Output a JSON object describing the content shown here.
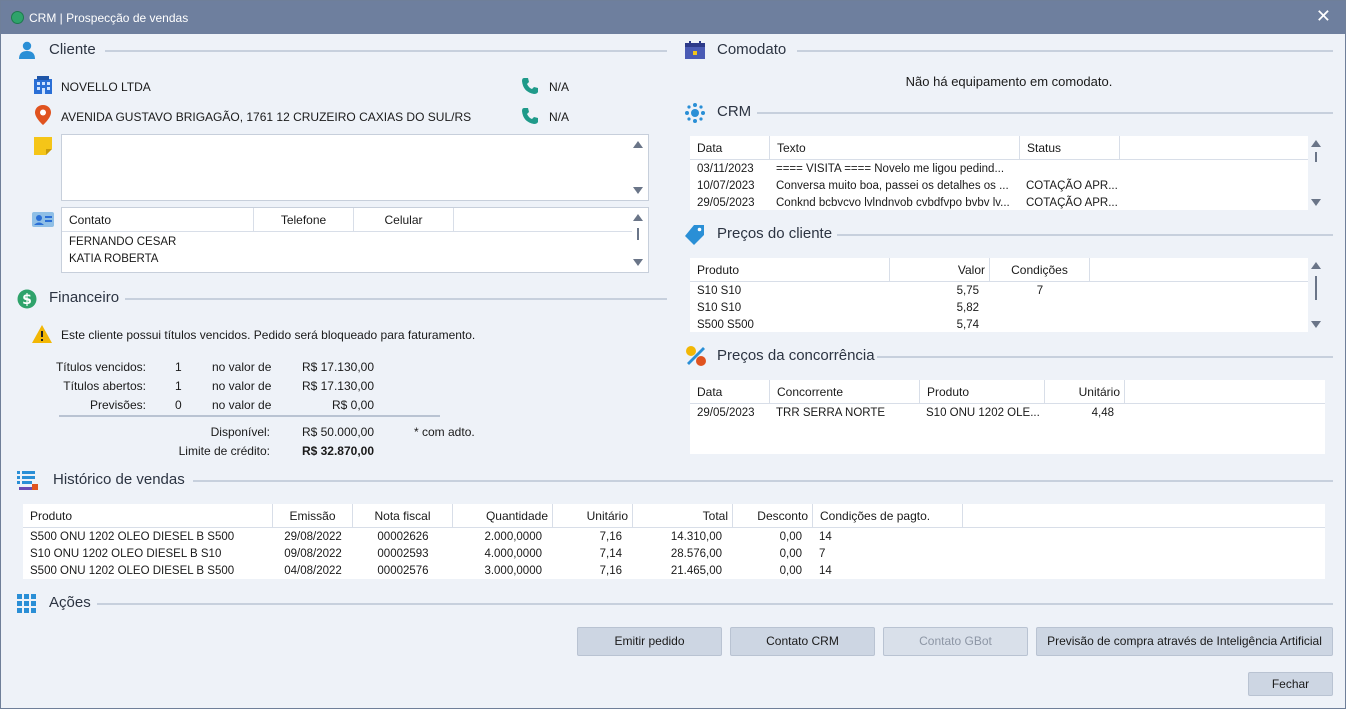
{
  "window": {
    "title": "CRM | Prospecção de vendas"
  },
  "cliente": {
    "section_title": "Cliente",
    "name": "NOVELLO LTDA",
    "address": "AVENIDA GUSTAVO BRIGAGÃO, 1761 12 CRUZEIRO CAXIAS DO SUL/RS",
    "phone1": "N/A",
    "phone2": "N/A",
    "notes": "",
    "contacts_headers": [
      "Contato",
      "Telefone",
      "Celular"
    ],
    "contacts": [
      {
        "contato": "FERNANDO CESAR",
        "telefone": "",
        "celular": ""
      },
      {
        "contato": "KATIA ROBERTA",
        "telefone": "",
        "celular": ""
      }
    ]
  },
  "financeiro": {
    "section_title": "Financeiro",
    "warning": "Este cliente possui títulos vencidos. Pedido será bloqueado para faturamento.",
    "rows": [
      {
        "label": "Títulos vencidos:",
        "count": "1",
        "mid": "no valor de",
        "value": "R$ 17.130,00"
      },
      {
        "label": "Títulos abertos:",
        "count": "1",
        "mid": "no valor de",
        "value": "R$ 17.130,00"
      },
      {
        "label": "Previsões:",
        "count": "0",
        "mid": "no valor de",
        "value": "R$ 0,00"
      }
    ],
    "disponivel_label": "Disponível:",
    "disponivel_value": "R$ 50.000,00",
    "adto_note": "* com adto.",
    "limite_label": "Limite de crédito:",
    "limite_value": "R$ 32.870,00"
  },
  "comodato": {
    "section_title": "Comodato",
    "message": "Não há equipamento em comodato."
  },
  "crm": {
    "section_title": "CRM",
    "headers": [
      "Data",
      "Texto",
      "Status"
    ],
    "rows": [
      {
        "data": "03/11/2023",
        "texto": "==== VISITA ==== Novelo me ligou pedind...",
        "status": ""
      },
      {
        "data": "10/07/2023",
        "texto": "Conversa muito boa, passei os detalhes os ...",
        "status": "COTAÇÃO APR..."
      },
      {
        "data": "29/05/2023",
        "texto": "Conknd bcbvcvo lvlndnvob cvbdfvpo bvbv lv...",
        "status": "COTAÇÃO APR..."
      }
    ]
  },
  "precos_cliente": {
    "section_title": "Preços do cliente",
    "headers": [
      "Produto",
      "Valor",
      "Condições"
    ],
    "rows": [
      {
        "produto": "S10 S10",
        "valor": "5,75",
        "condicoes": "7"
      },
      {
        "produto": "S10 S10",
        "valor": "5,82",
        "condicoes": ""
      },
      {
        "produto": "S500 S500",
        "valor": "5,74",
        "condicoes": ""
      }
    ]
  },
  "precos_concorrencia": {
    "section_title": "Preços da concorrência",
    "headers": [
      "Data",
      "Concorrente",
      "Produto",
      "Unitário"
    ],
    "rows": [
      {
        "data": "29/05/2023",
        "concorrente": "TRR SERRA NORTE",
        "produto": "S10 ONU 1202 OLE...",
        "unitario": "4,48"
      }
    ]
  },
  "historico": {
    "section_title": "Histórico de vendas",
    "headers": [
      "Produto",
      "Emissão",
      "Nota fiscal",
      "Quantidade",
      "Unitário",
      "Total",
      "Desconto",
      "Condições de pagto."
    ],
    "rows": [
      {
        "produto": "S500 ONU 1202 OLEO DIESEL B S500",
        "emissao": "29/08/2022",
        "nota": "00002626",
        "quantidade": "2.000,0000",
        "unitario": "7,16",
        "total": "14.310,00",
        "desconto": "0,00",
        "condicoes": "14"
      },
      {
        "produto": "S10 ONU 1202 OLEO DIESEL B S10",
        "emissao": "09/08/2022",
        "nota": "00002593",
        "quantidade": "4.000,0000",
        "unitario": "7,14",
        "total": "28.576,00",
        "desconto": "0,00",
        "condicoes": "7"
      },
      {
        "produto": "S500 ONU 1202 OLEO DIESEL B S500",
        "emissao": "04/08/2022",
        "nota": "00002576",
        "quantidade": "3.000,0000",
        "unitario": "7,16",
        "total": "21.465,00",
        "desconto": "0,00",
        "condicoes": "14"
      }
    ]
  },
  "acoes": {
    "section_title": "Ações",
    "buttons": {
      "emitir": "Emitir pedido",
      "contato_crm": "Contato CRM",
      "contato_gbot": "Contato GBot",
      "previsao": "Previsão de compra através de Inteligência Artificial",
      "fechar": "Fechar"
    }
  },
  "colors": {
    "titlebar": "#6e7f9e",
    "accent_blue": "#2a8fd6",
    "green": "#2fa36b",
    "warning": "#f2b705"
  }
}
